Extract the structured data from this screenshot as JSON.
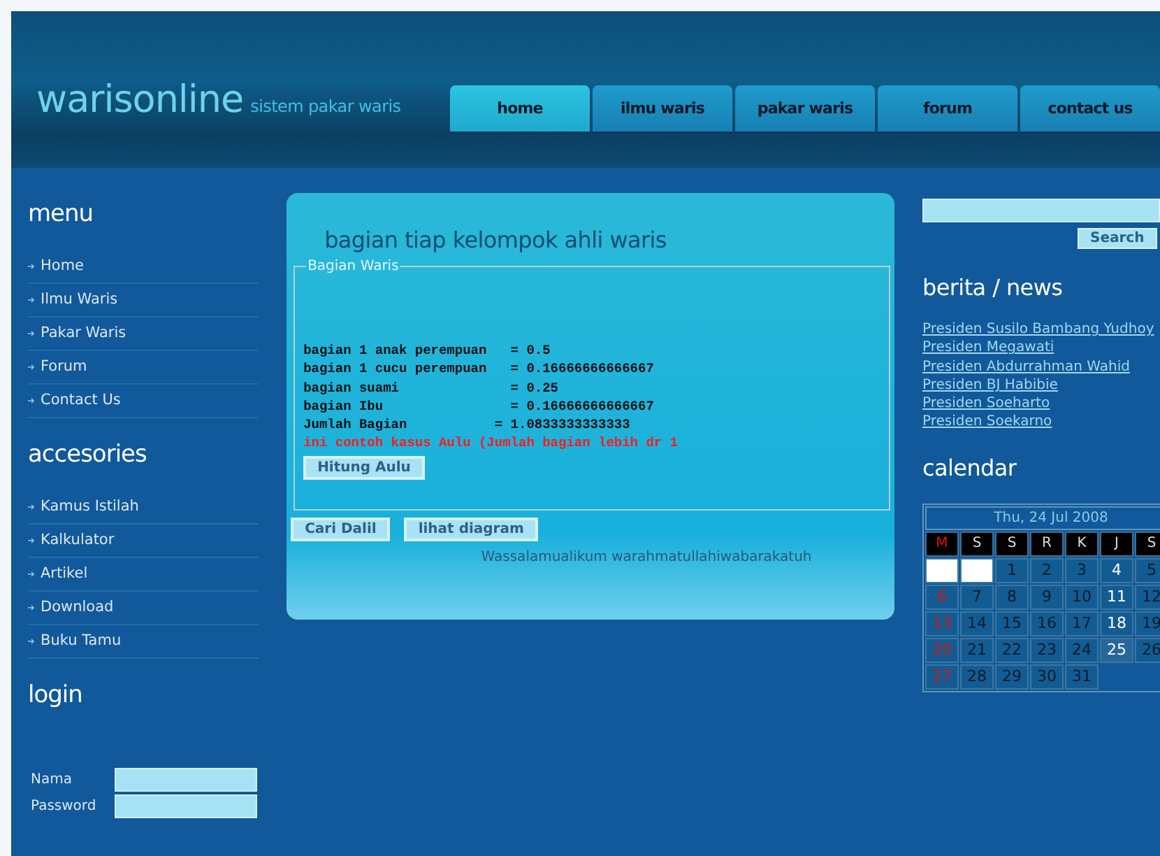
{
  "site": {
    "logo": "warisonline",
    "tagline": "sistem pakar waris"
  },
  "nav": [
    {
      "label": "home",
      "selected": true
    },
    {
      "label": "ilmu waris",
      "selected": false
    },
    {
      "label": "pakar waris",
      "selected": false
    },
    {
      "label": "forum",
      "selected": false
    },
    {
      "label": "contact us",
      "selected": false
    }
  ],
  "sidebar": {
    "sections": [
      {
        "title": "menu",
        "items": [
          "Home",
          "Ilmu Waris",
          "Pakar Waris",
          "Forum",
          "Contact Us"
        ]
      },
      {
        "title": "accesories",
        "items": [
          "Kamus Istilah",
          "Kalkulator",
          "Artikel",
          "Download",
          "Buku Tamu"
        ]
      }
    ],
    "login": {
      "title": "login",
      "fields": [
        {
          "label": "Nama"
        },
        {
          "label": "Password"
        }
      ]
    }
  },
  "main": {
    "title": "bagian tiap kelompok ahli waris",
    "legend": "Bagian Waris",
    "lines": [
      {
        "kind": "result",
        "text": "bagian 1 anak perempuan   = 0.5"
      },
      {
        "kind": "result",
        "text": "bagian 1 cucu perempuan   = 0.16666666666667"
      },
      {
        "kind": "result",
        "text": "bagian suami              = 0.25"
      },
      {
        "kind": "result",
        "text": "bagian Ibu                = 0.16666666666667"
      },
      {
        "kind": "result",
        "text": "Jumlah Bagian           = 1.0833333333333"
      },
      {
        "kind": "warning",
        "text": "ini contoh kasus Aulu (Jumlah bagian lebih dr 1"
      }
    ],
    "inner_button": "Hitung Aulu",
    "buttons": [
      "Cari Dalil",
      "lihat diagram"
    ],
    "footer": "Wassalamualikum warahmatullahiwabarakatuh"
  },
  "right": {
    "search_button": "Search",
    "news": {
      "title": "berita / news",
      "links": [
        "Presiden Susilo Bambang Yudhoy",
        "Presiden Megawati",
        "Presiden Abdurrahman Wahid",
        "Presiden BJ Habibie",
        "Presiden Soeharto",
        "Presiden Soekarno"
      ]
    },
    "calendar": {
      "title": "calendar",
      "caption": "Thu, 24 Jul 2008",
      "weekdays": [
        {
          "label": "M",
          "holiday": true
        },
        {
          "label": "S",
          "holiday": false
        },
        {
          "label": "S",
          "holiday": false
        },
        {
          "label": "R",
          "holiday": false
        },
        {
          "label": "K",
          "holiday": false
        },
        {
          "label": "J",
          "holiday": false
        },
        {
          "label": "S",
          "holiday": false
        }
      ],
      "weeks": [
        [
          {
            "kind": "blank"
          },
          {
            "kind": "blank"
          },
          {
            "kind": "day",
            "label": "1",
            "color": "#0a1a2a",
            "selected": false
          },
          {
            "kind": "day",
            "label": "2",
            "color": "#0a1a2a",
            "selected": false
          },
          {
            "kind": "day",
            "label": "3",
            "color": "#0a1a2a",
            "selected": false
          },
          {
            "kind": "day",
            "label": "4",
            "color": "#ffffff",
            "selected": false
          },
          {
            "kind": "day",
            "label": "5",
            "color": "#0a1a2a",
            "selected": false
          }
        ],
        [
          {
            "kind": "day",
            "label": "6",
            "color": "#d01818",
            "selected": false
          },
          {
            "kind": "day",
            "label": "7",
            "color": "#0a1a2a",
            "selected": false
          },
          {
            "kind": "day",
            "label": "8",
            "color": "#0a1a2a",
            "selected": false
          },
          {
            "kind": "day",
            "label": "9",
            "color": "#0a1a2a",
            "selected": false
          },
          {
            "kind": "day",
            "label": "10",
            "color": "#0a1a2a",
            "selected": false
          },
          {
            "kind": "day",
            "label": "11",
            "color": "#ffffff",
            "selected": false
          },
          {
            "kind": "day",
            "label": "12",
            "color": "#0a1a2a",
            "selected": false
          }
        ],
        [
          {
            "kind": "day",
            "label": "13",
            "color": "#d01818",
            "selected": false
          },
          {
            "kind": "day",
            "label": "14",
            "color": "#0a1a2a",
            "selected": false
          },
          {
            "kind": "day",
            "label": "15",
            "color": "#0a1a2a",
            "selected": false
          },
          {
            "kind": "day",
            "label": "16",
            "color": "#0a1a2a",
            "selected": false
          },
          {
            "kind": "day",
            "label": "17",
            "color": "#0a1a2a",
            "selected": false
          },
          {
            "kind": "day",
            "label": "18",
            "color": "#ffffff",
            "selected": false
          },
          {
            "kind": "day",
            "label": "19",
            "color": "#0a1a2a",
            "selected": false
          }
        ],
        [
          {
            "kind": "day",
            "label": "20",
            "color": "#d01818",
            "selected": false
          },
          {
            "kind": "day",
            "label": "21",
            "color": "#0a1a2a",
            "selected": false
          },
          {
            "kind": "day",
            "label": "22",
            "color": "#0a1a2a",
            "selected": false
          },
          {
            "kind": "day",
            "label": "23",
            "color": "#0a1a2a",
            "selected": false
          },
          {
            "kind": "day",
            "label": "24",
            "color": "#0a1a2a",
            "selected": false
          },
          {
            "kind": "day",
            "label": "25",
            "color": "#ffffff",
            "selected": true
          },
          {
            "kind": "day",
            "label": "26",
            "color": "#0a1a2a",
            "selected": false
          }
        ],
        [
          {
            "kind": "day",
            "label": "27",
            "color": "#d01818",
            "selected": false
          },
          {
            "kind": "day",
            "label": "28",
            "color": "#0a1a2a",
            "selected": false
          },
          {
            "kind": "day",
            "label": "29",
            "color": "#0a1a2a",
            "selected": false
          },
          {
            "kind": "day",
            "label": "30",
            "color": "#0a1a2a",
            "selected": false
          },
          {
            "kind": "day",
            "label": "31",
            "color": "#0a1a2a",
            "selected": false
          }
        ]
      ]
    }
  }
}
